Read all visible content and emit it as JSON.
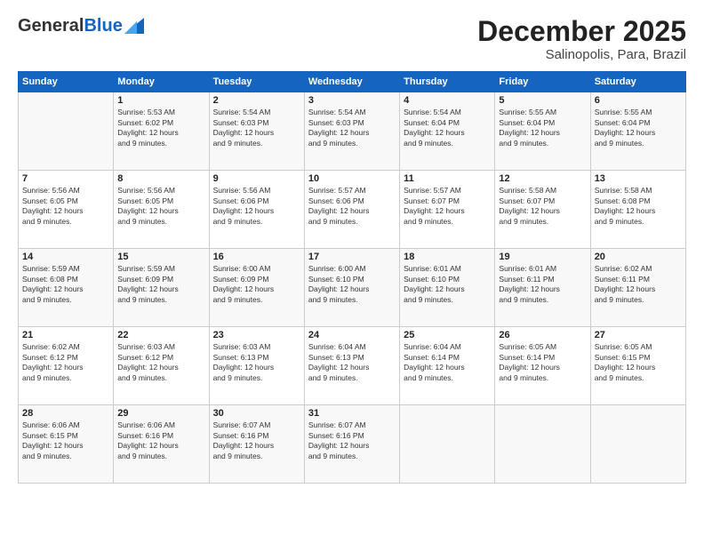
{
  "header": {
    "logo_general": "General",
    "logo_blue": "Blue",
    "month_title": "December 2025",
    "location": "Salinopolis, Para, Brazil"
  },
  "weekdays": [
    "Sunday",
    "Monday",
    "Tuesday",
    "Wednesday",
    "Thursday",
    "Friday",
    "Saturday"
  ],
  "weeks": [
    [
      {
        "day": "",
        "info": ""
      },
      {
        "day": "1",
        "info": "Sunrise: 5:53 AM\nSunset: 6:02 PM\nDaylight: 12 hours\nand 9 minutes."
      },
      {
        "day": "2",
        "info": "Sunrise: 5:54 AM\nSunset: 6:03 PM\nDaylight: 12 hours\nand 9 minutes."
      },
      {
        "day": "3",
        "info": "Sunrise: 5:54 AM\nSunset: 6:03 PM\nDaylight: 12 hours\nand 9 minutes."
      },
      {
        "day": "4",
        "info": "Sunrise: 5:54 AM\nSunset: 6:04 PM\nDaylight: 12 hours\nand 9 minutes."
      },
      {
        "day": "5",
        "info": "Sunrise: 5:55 AM\nSunset: 6:04 PM\nDaylight: 12 hours\nand 9 minutes."
      },
      {
        "day": "6",
        "info": "Sunrise: 5:55 AM\nSunset: 6:04 PM\nDaylight: 12 hours\nand 9 minutes."
      }
    ],
    [
      {
        "day": "7",
        "info": "Sunrise: 5:56 AM\nSunset: 6:05 PM\nDaylight: 12 hours\nand 9 minutes."
      },
      {
        "day": "8",
        "info": "Sunrise: 5:56 AM\nSunset: 6:05 PM\nDaylight: 12 hours\nand 9 minutes."
      },
      {
        "day": "9",
        "info": "Sunrise: 5:56 AM\nSunset: 6:06 PM\nDaylight: 12 hours\nand 9 minutes."
      },
      {
        "day": "10",
        "info": "Sunrise: 5:57 AM\nSunset: 6:06 PM\nDaylight: 12 hours\nand 9 minutes."
      },
      {
        "day": "11",
        "info": "Sunrise: 5:57 AM\nSunset: 6:07 PM\nDaylight: 12 hours\nand 9 minutes."
      },
      {
        "day": "12",
        "info": "Sunrise: 5:58 AM\nSunset: 6:07 PM\nDaylight: 12 hours\nand 9 minutes."
      },
      {
        "day": "13",
        "info": "Sunrise: 5:58 AM\nSunset: 6:08 PM\nDaylight: 12 hours\nand 9 minutes."
      }
    ],
    [
      {
        "day": "14",
        "info": "Sunrise: 5:59 AM\nSunset: 6:08 PM\nDaylight: 12 hours\nand 9 minutes."
      },
      {
        "day": "15",
        "info": "Sunrise: 5:59 AM\nSunset: 6:09 PM\nDaylight: 12 hours\nand 9 minutes."
      },
      {
        "day": "16",
        "info": "Sunrise: 6:00 AM\nSunset: 6:09 PM\nDaylight: 12 hours\nand 9 minutes."
      },
      {
        "day": "17",
        "info": "Sunrise: 6:00 AM\nSunset: 6:10 PM\nDaylight: 12 hours\nand 9 minutes."
      },
      {
        "day": "18",
        "info": "Sunrise: 6:01 AM\nSunset: 6:10 PM\nDaylight: 12 hours\nand 9 minutes."
      },
      {
        "day": "19",
        "info": "Sunrise: 6:01 AM\nSunset: 6:11 PM\nDaylight: 12 hours\nand 9 minutes."
      },
      {
        "day": "20",
        "info": "Sunrise: 6:02 AM\nSunset: 6:11 PM\nDaylight: 12 hours\nand 9 minutes."
      }
    ],
    [
      {
        "day": "21",
        "info": "Sunrise: 6:02 AM\nSunset: 6:12 PM\nDaylight: 12 hours\nand 9 minutes."
      },
      {
        "day": "22",
        "info": "Sunrise: 6:03 AM\nSunset: 6:12 PM\nDaylight: 12 hours\nand 9 minutes."
      },
      {
        "day": "23",
        "info": "Sunrise: 6:03 AM\nSunset: 6:13 PM\nDaylight: 12 hours\nand 9 minutes."
      },
      {
        "day": "24",
        "info": "Sunrise: 6:04 AM\nSunset: 6:13 PM\nDaylight: 12 hours\nand 9 minutes."
      },
      {
        "day": "25",
        "info": "Sunrise: 6:04 AM\nSunset: 6:14 PM\nDaylight: 12 hours\nand 9 minutes."
      },
      {
        "day": "26",
        "info": "Sunrise: 6:05 AM\nSunset: 6:14 PM\nDaylight: 12 hours\nand 9 minutes."
      },
      {
        "day": "27",
        "info": "Sunrise: 6:05 AM\nSunset: 6:15 PM\nDaylight: 12 hours\nand 9 minutes."
      }
    ],
    [
      {
        "day": "28",
        "info": "Sunrise: 6:06 AM\nSunset: 6:15 PM\nDaylight: 12 hours\nand 9 minutes."
      },
      {
        "day": "29",
        "info": "Sunrise: 6:06 AM\nSunset: 6:16 PM\nDaylight: 12 hours\nand 9 minutes."
      },
      {
        "day": "30",
        "info": "Sunrise: 6:07 AM\nSunset: 6:16 PM\nDaylight: 12 hours\nand 9 minutes."
      },
      {
        "day": "31",
        "info": "Sunrise: 6:07 AM\nSunset: 6:16 PM\nDaylight: 12 hours\nand 9 minutes."
      },
      {
        "day": "",
        "info": ""
      },
      {
        "day": "",
        "info": ""
      },
      {
        "day": "",
        "info": ""
      }
    ]
  ]
}
